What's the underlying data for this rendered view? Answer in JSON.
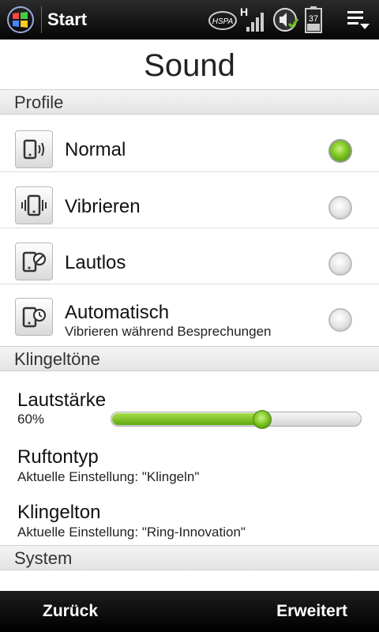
{
  "statusbar": {
    "title": "Start",
    "battery_level": "37",
    "network_label": "HSPA",
    "network_type": "H",
    "icons": [
      "windows-start-icon",
      "hspa-icon",
      "signal-strength-icon",
      "volume-icon",
      "battery-icon",
      "menu-icon"
    ]
  },
  "page": {
    "title": "Sound"
  },
  "profiles": {
    "header": "Profile",
    "items": [
      {
        "label": "Normal",
        "sublabel": "",
        "icon": "phone-ringing-icon",
        "selected": true
      },
      {
        "label": "Vibrieren",
        "sublabel": "",
        "icon": "phone-vibrate-icon",
        "selected": false
      },
      {
        "label": "Lautlos",
        "sublabel": "",
        "icon": "phone-silent-icon",
        "selected": false
      },
      {
        "label": "Automatisch",
        "sublabel": "Vibrieren während Besprechungen",
        "icon": "phone-clock-icon",
        "selected": false
      }
    ]
  },
  "ringtones": {
    "header": "Klingeltöne",
    "volume": {
      "label": "Lautstärke",
      "value_text": "60%",
      "value": 0.6
    },
    "ring_type": {
      "label": "Ruftontyp",
      "current": "Aktuelle Einstellung: \"Klingeln\""
    },
    "ringtone": {
      "label": "Klingelton",
      "current": "Aktuelle Einstellung: \"Ring-Innovation\""
    }
  },
  "system": {
    "header": "System"
  },
  "softkeys": {
    "left": "Zurück",
    "right": "Erweitert"
  },
  "colors": {
    "accent": "#6cbf1a",
    "bar": "#000000"
  }
}
